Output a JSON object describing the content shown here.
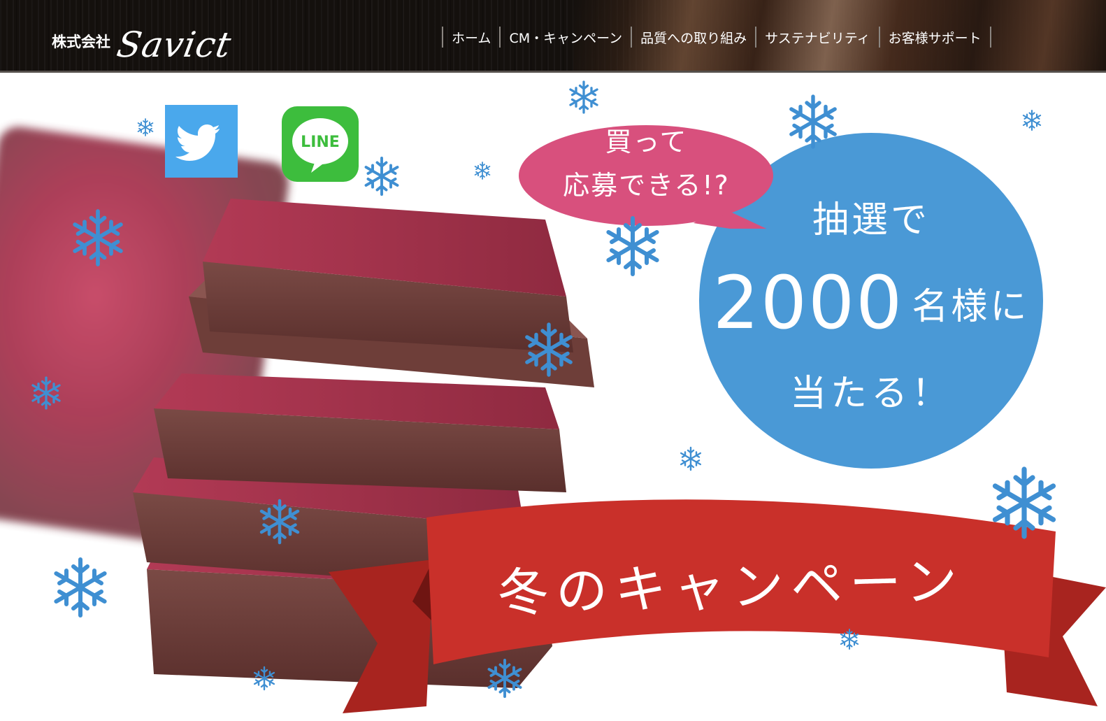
{
  "header": {
    "logo": {
      "corp_label": "株式会社",
      "brand_name": "Savict"
    },
    "nav": [
      {
        "label": "ホーム"
      },
      {
        "label": "CM・キャンペーン"
      },
      {
        "label": "品質への取り組み"
      },
      {
        "label": "サステナビリティ"
      },
      {
        "label": "お客様サポート"
      }
    ]
  },
  "hero": {
    "social": {
      "twitter_icon": "twitter-bird-icon",
      "line_label": "LINE"
    },
    "speech_bubble": {
      "line1": "買って",
      "line2": "応募できる!?"
    },
    "prize_circle": {
      "line1": "抽選で",
      "number": "2000",
      "suffix": "名様に",
      "line3": "当たる！"
    },
    "banner": {
      "title": "冬のキャンペーン"
    }
  },
  "colors": {
    "header_bg": "#14100d",
    "twitter_blue": "#4aa8ec",
    "line_green": "#3dbd3d",
    "bubble_pink": "#d8507d",
    "circle_blue": "#4a99d6",
    "ribbon_red": "#c9302a",
    "snowflake_blue": "#3f8fd2"
  }
}
